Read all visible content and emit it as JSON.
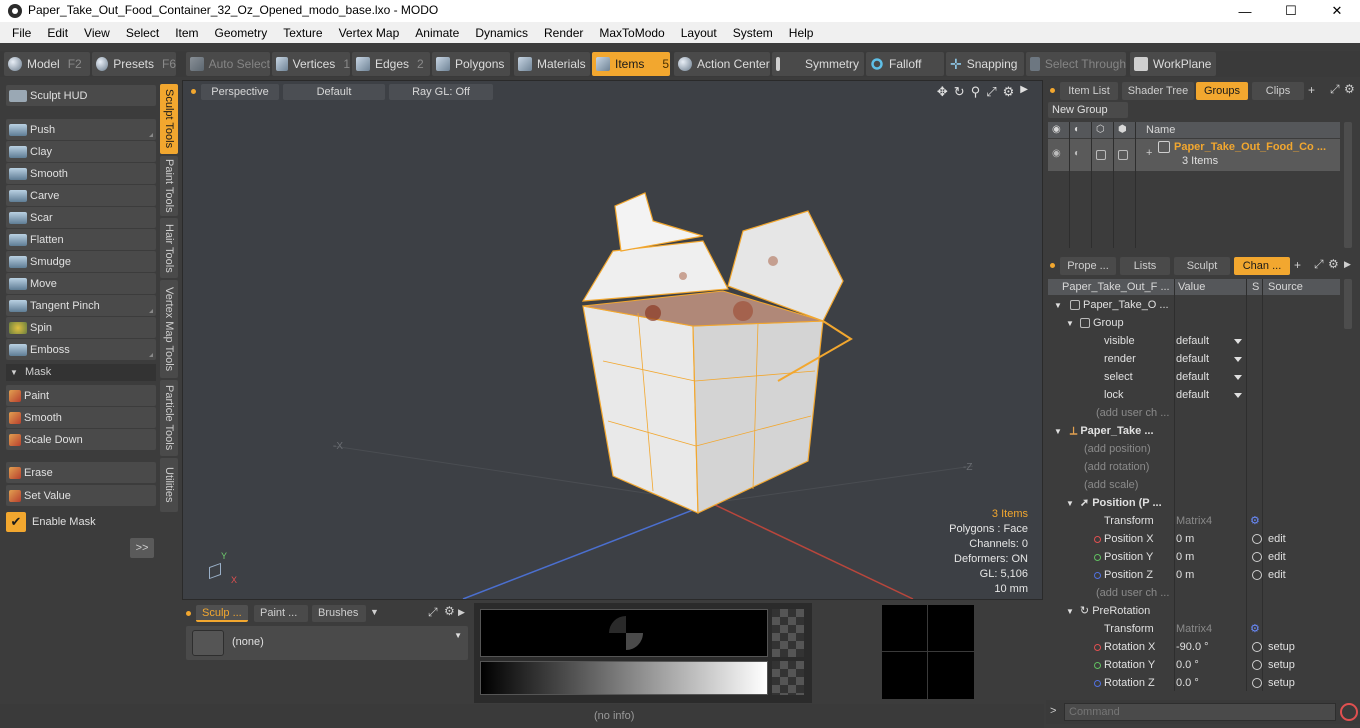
{
  "window": {
    "title": "Paper_Take_Out_Food_Container_32_Oz_Opened_modo_base.lxo - MODO",
    "minimize": "—",
    "maximize": "☐",
    "close": "✕"
  },
  "menu": [
    "File",
    "Edit",
    "View",
    "Select",
    "Item",
    "Geometry",
    "Texture",
    "Vertex Map",
    "Animate",
    "Dynamics",
    "Render",
    "MaxToModo",
    "Layout",
    "System",
    "Help"
  ],
  "toolbar": {
    "model": "Model",
    "model_key": "F2",
    "presets": "Presets",
    "presets_key": "F6",
    "auto_select": "Auto Select",
    "vertices": "Vertices",
    "vertices_key": "1",
    "edges": "Edges",
    "edges_key": "2",
    "polygons": "Polygons",
    "materials": "Materials",
    "items": "Items",
    "items_key": "5",
    "action_center": "Action Center",
    "symmetry": "Symmetry",
    "falloff": "Falloff",
    "snapping": "Snapping",
    "select_through": "Select Through",
    "workplane": "WorkPlane"
  },
  "left": {
    "sculpt_hud": "Sculpt HUD",
    "tools": [
      "Push",
      "Clay",
      "Smooth",
      "Carve",
      "Scar",
      "Flatten",
      "Smudge",
      "Move",
      "Tangent Pinch",
      "Spin",
      "Emboss"
    ],
    "mask_header": "Mask",
    "mask_tools": [
      "Paint",
      "Smooth",
      "Scale Down"
    ],
    "extra_tools": [
      "Erase",
      "Set Value"
    ],
    "enable_mask": "Enable Mask",
    "more": ">>",
    "vtabs": [
      "Sculpt Tools",
      "Paint Tools",
      "Hair Tools",
      "Vertex Map Tools",
      "Particle Tools",
      "Utilities"
    ]
  },
  "viewport": {
    "view": "Perspective",
    "shading": "Default",
    "raygl": "Ray GL: Off",
    "axis_left": "-X",
    "axis_right": "-Z",
    "gizmo_y": "Y",
    "gizmo_x": "X",
    "info": {
      "items": "3 Items",
      "polygons": "Polygons : Face",
      "channels": "Channels: 0",
      "deformers": "Deformers: ON",
      "gl": "GL: 5,106",
      "unit": "10 mm"
    }
  },
  "brush": {
    "tabs": [
      "Sculp ...",
      "Paint ...",
      "Brushes"
    ],
    "none": "(none)"
  },
  "status": {
    "info": "(no info)",
    "command_placeholder": "Command"
  },
  "rightTop": {
    "tabs": [
      "Item List",
      "Shader Tree",
      "Groups",
      "Clips"
    ],
    "new_group": "New Group",
    "col_name": "Name",
    "group_name": "Paper_Take_Out_Food_Co ...",
    "group_count": "3 Items"
  },
  "rightBot": {
    "tabs": [
      "Prope ...",
      "Lists",
      "Sculpt",
      "Chan ..."
    ],
    "col_item": "Paper_Take_Out_F ...",
    "col_value": "Value",
    "col_s": "S",
    "col_source": "Source",
    "rows": {
      "r0": "Paper_Take_O ...",
      "r1": "Group",
      "r2": "visible",
      "r2v": "default",
      "r3": "render",
      "r3v": "default",
      "r4": "select",
      "r4v": "default",
      "r5": "lock",
      "r5v": "default",
      "r6": "(add user ch ...",
      "r7": "Paper_Take ...",
      "r8": "(add position)",
      "r9": "(add rotation)",
      "r10": "(add scale)",
      "r11": "Position (P ...",
      "r12": "Transform",
      "r12v": "Matrix4",
      "r13": "Position X",
      "r13v": "0 m",
      "r13s": "edit",
      "r14": "Position Y",
      "r14v": "0 m",
      "r14s": "edit",
      "r15": "Position Z",
      "r15v": "0 m",
      "r15s": "edit",
      "r16": "(add user ch ...",
      "r17": "PreRotation",
      "r18": "Transform",
      "r18v": "Matrix4",
      "r19": "Rotation X",
      "r19v": "-90.0 °",
      "r19s": "setup",
      "r20": "Rotation Y",
      "r20v": "0.0 °",
      "r20s": "setup",
      "r21": "Rotation Z",
      "r21v": "0.0 °",
      "r21s": "setup"
    }
  },
  "colors": {
    "accent": "#f2a72f",
    "panel": "#3c3c3c",
    "viewport": "#3d4045"
  }
}
